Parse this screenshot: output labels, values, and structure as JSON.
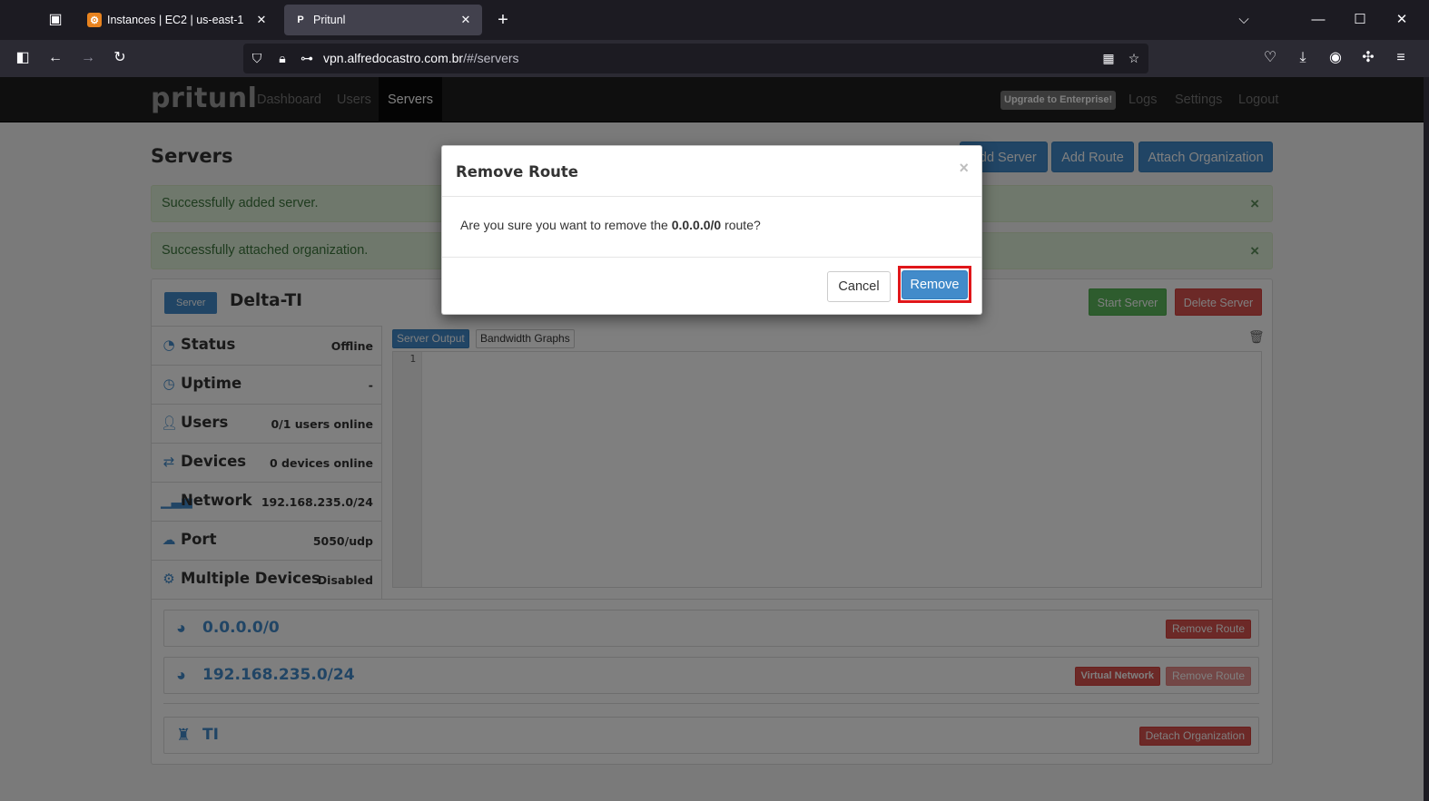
{
  "browser": {
    "tabs": [
      {
        "title": "Instances | EC2 | us-east-1",
        "favicon": "aws-icon",
        "active": false
      },
      {
        "title": "Pritunl",
        "favicon": "pritunl-icon",
        "active": true
      }
    ],
    "url_host": "vpn.alfredocastro.com.br",
    "url_path": "/#/servers"
  },
  "topnav": {
    "brand": "pritunl",
    "links": [
      "Dashboard",
      "Users",
      "Servers"
    ],
    "upgrade": "Upgrade to Enterprise!",
    "right_links": [
      "Logs",
      "Settings",
      "Logout"
    ]
  },
  "page": {
    "title": "Servers",
    "buttons": {
      "add_server": "Add Server",
      "add_route": "Add Route",
      "attach_org": "Attach Organization"
    },
    "alerts": [
      "Successfully added server.",
      "Successfully attached organization."
    ]
  },
  "server": {
    "label": "Server",
    "name": "Delta-TI",
    "start": "Start Server",
    "delete": "Delete Server",
    "info": [
      {
        "icon": "dashboard-icon",
        "label": "Status",
        "value": "Offline"
      },
      {
        "icon": "clock-icon",
        "label": "Uptime",
        "value": "-"
      },
      {
        "icon": "user-icon",
        "label": "Users",
        "value": "0/1 users online"
      },
      {
        "icon": "transfer-icon",
        "label": "Devices",
        "value": "0 devices online"
      },
      {
        "icon": "signal-icon",
        "label": "Network",
        "value": "192.168.235.0/24"
      },
      {
        "icon": "cloud-upload-icon",
        "label": "Port",
        "value": "5050/udp"
      },
      {
        "icon": "cog-icon",
        "label": "Multiple Devices",
        "value": "Disabled"
      }
    ],
    "output_tabs": [
      "Server Output",
      "Bandwidth Graphs"
    ],
    "line_number": "1",
    "routes": [
      {
        "network": "0.0.0.0/0",
        "remove": "Remove Route"
      },
      {
        "network": "192.168.235.0/24",
        "badge": "Virtual Network",
        "remove": "Remove Route"
      }
    ],
    "organization": {
      "name": "TI",
      "detach": "Detach Organization"
    }
  },
  "modal": {
    "title": "Remove Route",
    "text_before": "Are you sure you want to remove the ",
    "route": "0.0.0.0/0",
    "text_after": " route?",
    "cancel": "Cancel",
    "confirm": "Remove",
    "close": "×"
  },
  "colors": {
    "primary": "#428bca",
    "success": "#5cb85c",
    "danger": "#d9534f",
    "highlight": "#e0161a"
  }
}
